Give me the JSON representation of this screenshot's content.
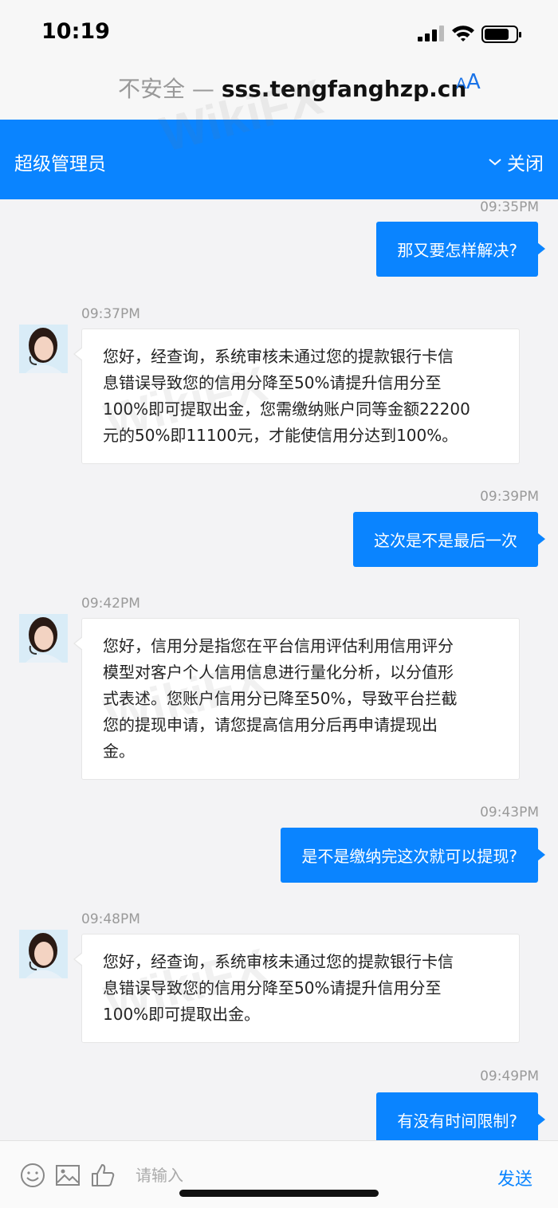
{
  "status_bar": {
    "time": "10:19"
  },
  "browser": {
    "insecure_label": "不安全 — ",
    "host": "sss.tengfanghzp.cn",
    "text_size_label_small": "A",
    "text_size_label_large": "A"
  },
  "header": {
    "title": "超级管理员",
    "close_label": "关闭"
  },
  "watermark": "WikiFX",
  "messages": [
    {
      "direction": "out",
      "time": "09:35PM",
      "text": "那又要怎样解决?"
    },
    {
      "direction": "in",
      "time": "09:37PM",
      "lines": [
        "您好，经查询，系统审核未通过您的提款银行卡信",
        "息错误导致您的信用分降至50%请提升信用分至",
        "100%即可提取出金，您需缴纳账户同等金额22200",
        "元的50%即11100元，才能使信用分达到100%。"
      ]
    },
    {
      "direction": "out",
      "time": "09:39PM",
      "text": "这次是不是最后一次"
    },
    {
      "direction": "in",
      "time": "09:42PM",
      "lines": [
        "您好，信用分是指您在平台信用评估利用信用评分",
        "模型对客户个人信用信息进行量化分析，以分值形",
        "式表述。您账户信用分已降至50%，导致平台拦截",
        "您的提现申请，请您提高信用分后再申请提现出",
        "金。"
      ]
    },
    {
      "direction": "out",
      "time": "09:43PM",
      "text": "是不是缴纳完这次就可以提现?"
    },
    {
      "direction": "in",
      "time": "09:48PM",
      "lines": [
        "您好，经查询，系统审核未通过您的提款银行卡信",
        "息错误导致您的信用分降至50%请提升信用分至",
        "100%即可提取出金。"
      ]
    },
    {
      "direction": "out",
      "time": "09:49PM",
      "text": "有没有时间限制?"
    }
  ],
  "input": {
    "placeholder": "请输入",
    "value": "",
    "send_label": "发送"
  },
  "icons": [
    "signal-icon",
    "wifi-icon",
    "battery-icon",
    "chevron-down-icon",
    "emoji-icon",
    "image-icon",
    "thumbs-up-icon",
    "avatar"
  ],
  "colors": {
    "accent": "#0a84ff"
  }
}
